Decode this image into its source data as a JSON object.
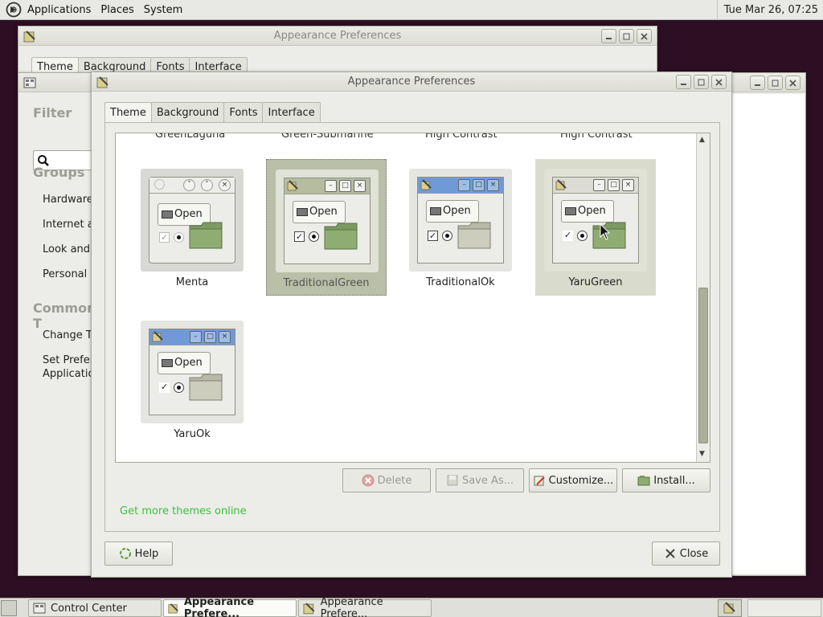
{
  "top_panel": {
    "menus": [
      "Applications",
      "Places",
      "System"
    ],
    "clock": "Tue Mar 26, 07:25"
  },
  "back_window": {
    "title": "Appearance Preferences",
    "tabs": [
      "Theme",
      "Background",
      "Fonts",
      "Interface"
    ]
  },
  "control_center": {
    "filter_label": "Filter",
    "groups_label": "Groups",
    "group_items": [
      "Hardware",
      "Internet ar",
      "Look and F",
      "Personal"
    ],
    "common_label": "Common T",
    "common_items": [
      "Change Th",
      "Set Prefere",
      "Applicatio"
    ]
  },
  "main_window": {
    "title": "Appearance Preferences",
    "tabs": [
      "Theme",
      "Background",
      "Fonts",
      "Interface"
    ],
    "cut_labels": [
      "GreenLaguna",
      "Green-Submarine",
      "High Contrast",
      "High Contrast"
    ],
    "themes": [
      {
        "name": "Menta",
        "state": "normal"
      },
      {
        "name": "TraditionalGreen",
        "state": "selected"
      },
      {
        "name": "TraditionalOk",
        "state": "normal"
      },
      {
        "name": "YaruGreen",
        "state": "hover"
      },
      {
        "name": "YaruOk",
        "state": "normal"
      }
    ],
    "preview_open_label": "Open",
    "buttons": {
      "delete": "Delete",
      "save_as": "Save As...",
      "customize": "Customize...",
      "install": "Install..."
    },
    "get_more": "Get more themes online",
    "help": "Help",
    "close": "Close"
  },
  "taskbar": {
    "tasks": [
      {
        "label": "Control Center",
        "active": false
      },
      {
        "label": "Appearance Prefere...",
        "active": true
      },
      {
        "label": "Appearance Prefere...",
        "active": false
      }
    ]
  },
  "colors": {
    "desktop": "#2c0f22",
    "selection": "#b9bfa8",
    "link": "#3ec13e",
    "preview_blue_bar": "#6f9ad6"
  }
}
